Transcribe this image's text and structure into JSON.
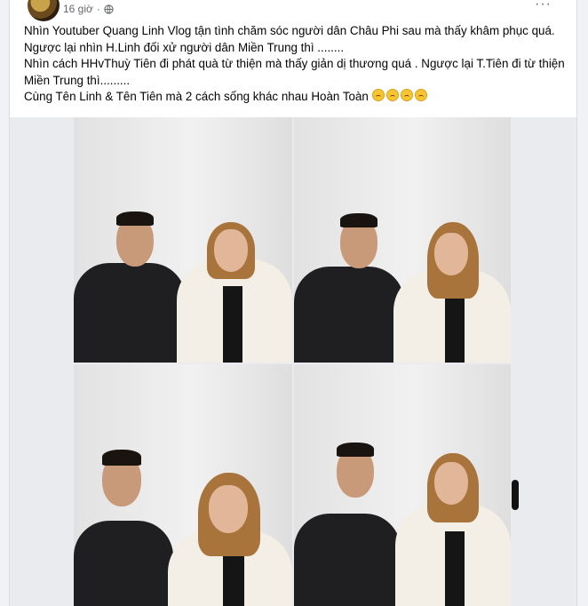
{
  "post": {
    "timestamp": "16 giờ",
    "privacy_icon": "globe-icon",
    "text_lines": [
      "Nhìn Youtuber Quang Linh Vlog tận tình chăm sóc người dân Châu Phi sau mà thấy khâm phục quá. Ngược lại nhìn H.Linh đối xử người dân Miền Trung thì ........",
      "Nhìn cách HHvThuỳ Tiên đi phát quà từ thiện mà thấy giản dị thương quá . Ngược lại T.Tiên đi từ thiện Miền Trung thì.........",
      "Cùng Tên Linh & Tên Tiên mà 2 cách sống khác nhau Hoàn Toàn"
    ],
    "emoji_count": 4,
    "emoji_icon": "tired-face-emoji-icon"
  },
  "gallery": {
    "photo_count": 4
  }
}
